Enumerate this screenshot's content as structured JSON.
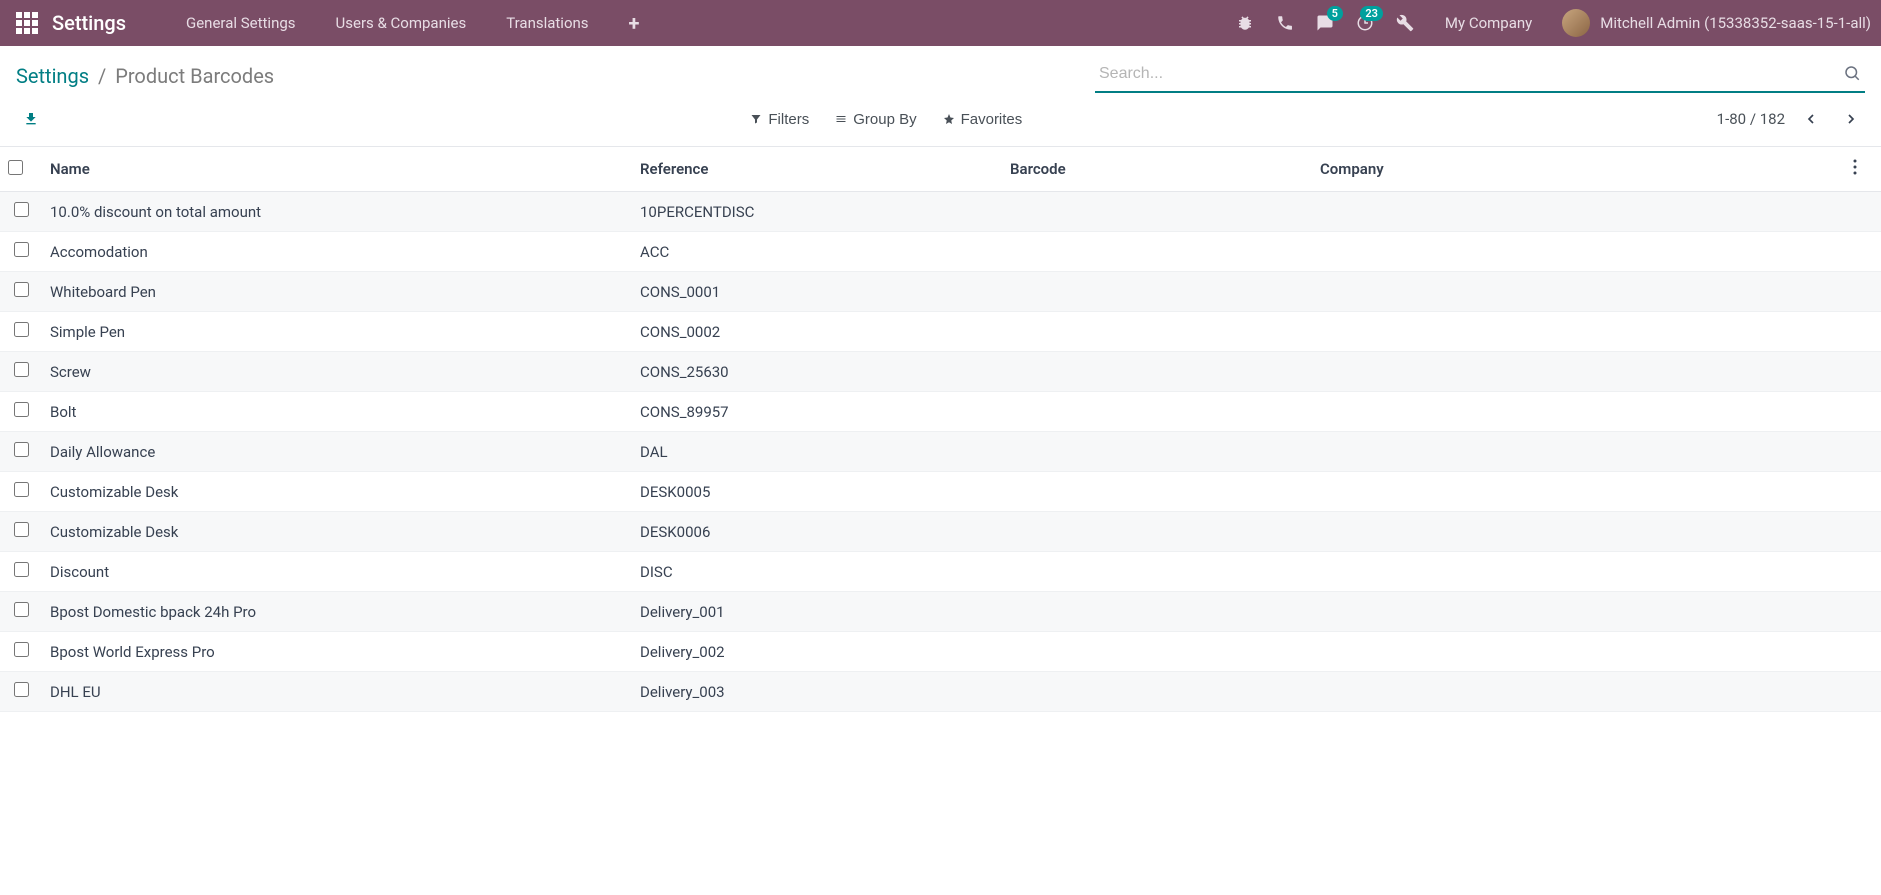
{
  "navbar": {
    "app_title": "Settings",
    "menu": [
      "General Settings",
      "Users & Companies",
      "Translations"
    ],
    "badges": {
      "messages": "5",
      "activities": "23"
    },
    "company": "My Company",
    "user": "Mitchell Admin (15338352-saas-15-1-all)"
  },
  "breadcrumb": {
    "root": "Settings",
    "current": "Product Barcodes"
  },
  "search": {
    "placeholder": "Search..."
  },
  "filters": {
    "filters_label": "Filters",
    "groupby_label": "Group By",
    "favorites_label": "Favorites"
  },
  "pager": {
    "range": "1-80 / 182"
  },
  "table": {
    "columns": {
      "name": "Name",
      "reference": "Reference",
      "barcode": "Barcode",
      "company": "Company"
    },
    "rows": [
      {
        "name": "10.0% discount on total amount",
        "reference": "10PERCENTDISC",
        "barcode": "",
        "company": ""
      },
      {
        "name": "Accomodation",
        "reference": "ACC",
        "barcode": "",
        "company": ""
      },
      {
        "name": "Whiteboard Pen",
        "reference": "CONS_0001",
        "barcode": "",
        "company": ""
      },
      {
        "name": "Simple Pen",
        "reference": "CONS_0002",
        "barcode": "",
        "company": ""
      },
      {
        "name": "Screw",
        "reference": "CONS_25630",
        "barcode": "",
        "company": ""
      },
      {
        "name": "Bolt",
        "reference": "CONS_89957",
        "barcode": "",
        "company": ""
      },
      {
        "name": "Daily Allowance",
        "reference": "DAL",
        "barcode": "",
        "company": ""
      },
      {
        "name": "Customizable Desk",
        "reference": "DESK0005",
        "barcode": "",
        "company": ""
      },
      {
        "name": "Customizable Desk",
        "reference": "DESK0006",
        "barcode": "",
        "company": ""
      },
      {
        "name": "Discount",
        "reference": "DISC",
        "barcode": "",
        "company": ""
      },
      {
        "name": "Bpost Domestic bpack 24h Pro",
        "reference": "Delivery_001",
        "barcode": "",
        "company": ""
      },
      {
        "name": "Bpost World Express Pro",
        "reference": "Delivery_002",
        "barcode": "",
        "company": ""
      },
      {
        "name": "DHL EU",
        "reference": "Delivery_003",
        "barcode": "",
        "company": ""
      }
    ]
  }
}
